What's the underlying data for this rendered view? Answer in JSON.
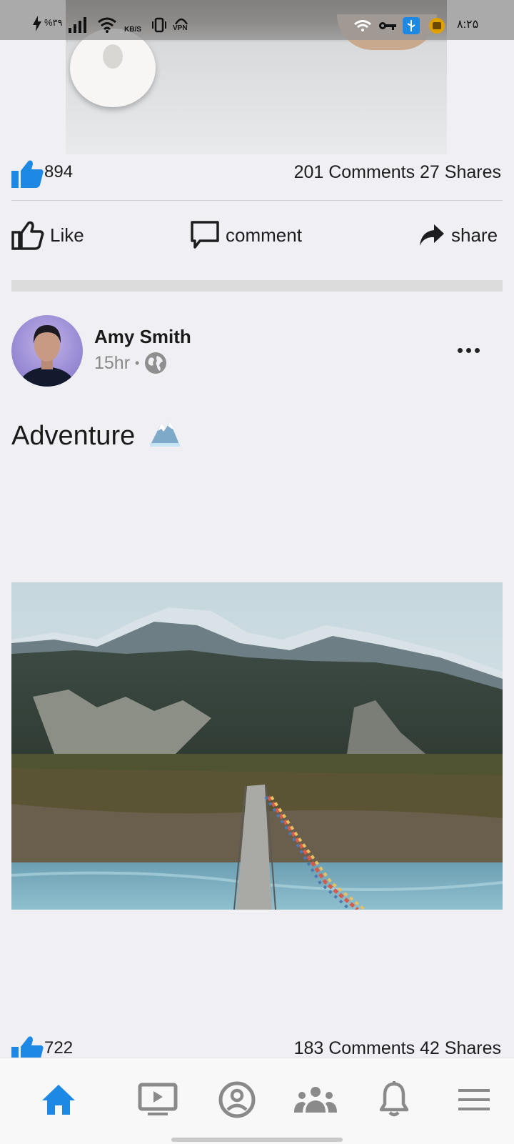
{
  "status_bar": {
    "battery": "%۳۹",
    "speed_unit": "KB/S",
    "vpn": "VPN",
    "time": "۸:۲۵",
    "icons": [
      "charging-icon",
      "signal-icon",
      "wifi-icon",
      "vibrate-icon",
      "vpn-icon",
      "hotspot-icon",
      "key-icon",
      "usb-icon",
      "download-icon"
    ]
  },
  "previous_post": {
    "like_count": "894",
    "engagement": "201 Comments 27 Shares"
  },
  "actions": {
    "like": "Like",
    "comment": "comment",
    "share": "share"
  },
  "post": {
    "author": "Amy Smith",
    "time": "15hr",
    "separator": "•",
    "visibility_icon": "globe-icon",
    "text": "Adventure",
    "emoji": "mountain-snow-icon",
    "like_count": "722",
    "engagement": "183 Comments 42 Shares"
  },
  "bottom_nav": {
    "items": [
      "home-icon",
      "video-icon",
      "profile-icon",
      "groups-icon",
      "notifications-icon",
      "menu-icon"
    ],
    "active": "home-icon"
  },
  "colors": {
    "accent": "#1e88e5",
    "background": "#f0f0f4",
    "icon_gray": "#8a8a8a"
  }
}
